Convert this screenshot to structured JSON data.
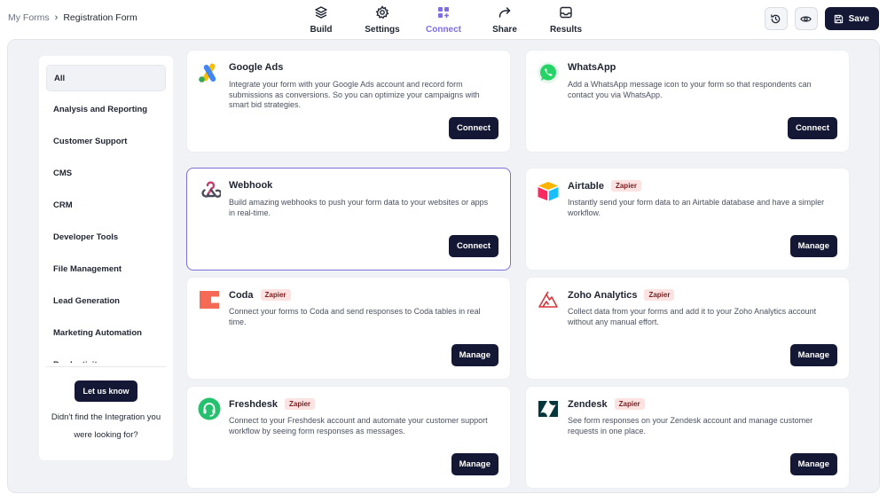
{
  "breadcrumb": {
    "root": "My Forms",
    "separator": "›",
    "current": "Registration Form"
  },
  "nav": [
    {
      "label": "Build",
      "icon": "layers-icon"
    },
    {
      "label": "Settings",
      "icon": "gear-icon"
    },
    {
      "label": "Connect",
      "icon": "grid-plus-icon",
      "active": true
    },
    {
      "label": "Share",
      "icon": "share-arrow-icon"
    },
    {
      "label": "Results",
      "icon": "inbox-icon"
    }
  ],
  "actions": {
    "history_icon": "history-icon",
    "preview_icon": "eye-icon",
    "save_label": "Save"
  },
  "sidebar": {
    "categories": [
      "All",
      "Analysis and Reporting",
      "Customer Support",
      "CMS",
      "CRM",
      "Developer Tools",
      "File Management",
      "Lead Generation",
      "Marketing Automation",
      "Productivity"
    ],
    "active_category": "All",
    "let_us_know_label": "Let us know",
    "help_text": "Didn't find the Integration you were looking for?"
  },
  "integrations": [
    {
      "name": "Google Ads",
      "badge": "",
      "description": "Integrate your form with your Google Ads account and record form submissions as conversions. So you can optimize your campaigns with smart bid strategies.",
      "button": "Connect",
      "icon": "google-ads-icon"
    },
    {
      "name": "WhatsApp",
      "badge": "",
      "description": "Add a WhatsApp message icon to your form so that respondents can contact you via WhatsApp.",
      "button": "Connect",
      "icon": "whatsapp-icon"
    },
    {
      "name": "Webhook",
      "badge": "",
      "description": "Build amazing webhooks to push your form data to your websites or apps in real-time.",
      "button": "Connect",
      "icon": "webhook-icon",
      "selected": true
    },
    {
      "name": "Airtable",
      "badge": "Zapier",
      "description": "Instantly send your form data to an Airtable database and have a simpler workflow.",
      "button": "Manage",
      "icon": "airtable-icon"
    },
    {
      "name": "Coda",
      "badge": "Zapier",
      "description": "Connect your forms to Coda and send responses to Coda tables in real time.",
      "button": "Manage",
      "icon": "coda-icon"
    },
    {
      "name": "Zoho Analytics",
      "badge": "Zapier",
      "description": "Collect data from your forms and add it to your Zoho Analytics account without any manual effort.",
      "button": "Manage",
      "icon": "zoho-analytics-icon"
    },
    {
      "name": "Freshdesk",
      "badge": "Zapier",
      "description": "Connect to your Freshdesk account and automate your customer support workflow by seeing form responses as messages.",
      "button": "Manage",
      "icon": "freshdesk-icon"
    },
    {
      "name": "Zendesk",
      "badge": "Zapier",
      "description": "See form responses on your Zendesk account and manage customer requests in one place.",
      "button": "Manage",
      "icon": "zendesk-icon"
    }
  ],
  "colors": {
    "primary_dark": "#151834",
    "accent": "#7c6ee6",
    "badge_bg": "#fde2e2",
    "badge_text": "#7a1f1f"
  }
}
